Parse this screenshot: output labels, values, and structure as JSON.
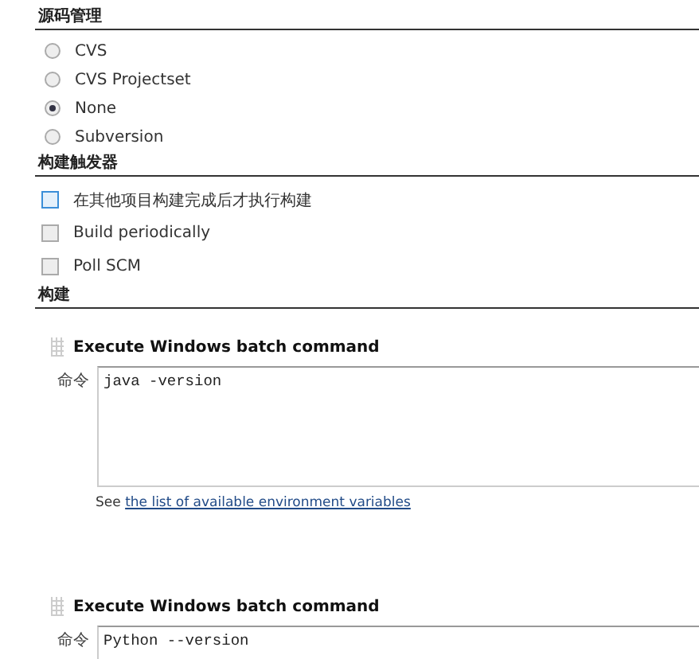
{
  "sections": [
    {
      "title": "源码管理",
      "kind": "radio",
      "options": [
        {
          "label": "CVS",
          "selected": false
        },
        {
          "label": "CVS Projectset",
          "selected": false
        },
        {
          "label": "None",
          "selected": true
        },
        {
          "label": "Subversion",
          "selected": false
        }
      ]
    },
    {
      "title": "构建触发器",
      "kind": "checkbox",
      "options": [
        {
          "label": "在其他项目构建完成后才执行构建",
          "checked": false,
          "focused": true
        },
        {
          "label": "Build periodically",
          "checked": false,
          "focused": false
        },
        {
          "label": "Poll SCM",
          "checked": false,
          "focused": false
        }
      ]
    },
    {
      "title": "构建",
      "kind": "steps",
      "steps": [
        {
          "title": "Execute Windows batch command",
          "field_label": "命令",
          "command": "java -version",
          "help_prefix": "See",
          "help_link": "the list of available environment variables"
        },
        {
          "title": "Execute Windows batch command",
          "field_label": "命令",
          "command": "Python --version"
        }
      ]
    }
  ]
}
